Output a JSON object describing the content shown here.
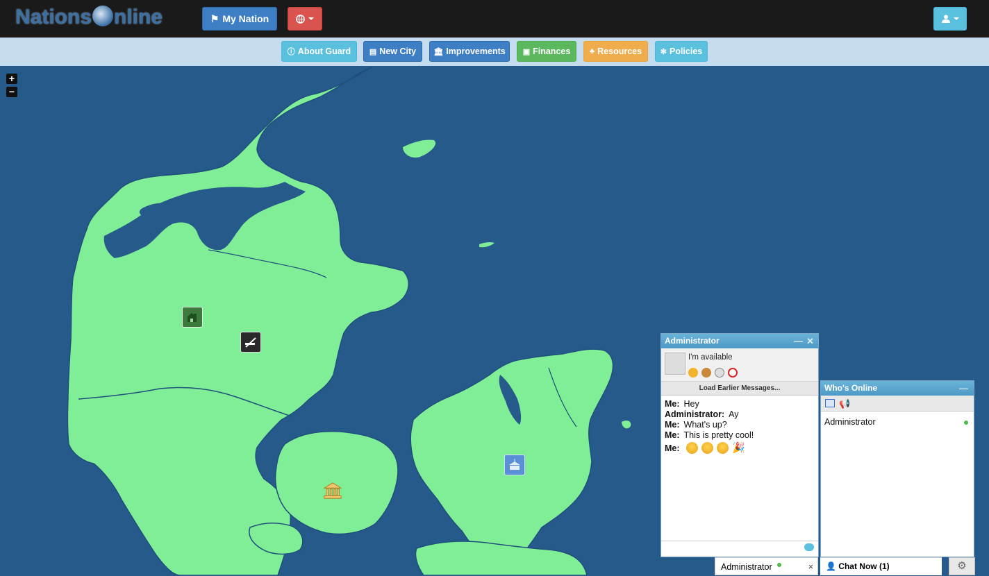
{
  "header": {
    "logo_text": "Nations",
    "logo_text2": "nline",
    "my_nation_label": "My Nation"
  },
  "subnav": {
    "about_guard": "About Guard",
    "new_city": "New City",
    "improvements": "Improvements",
    "finances": "Finances",
    "resources": "Resources",
    "policies": "Policies"
  },
  "map": {
    "zoom_in": "+",
    "zoom_out": "−",
    "land_color": "#80ee96",
    "water_color": "#265a8b"
  },
  "chat": {
    "title": "Administrator",
    "status": "I'm available",
    "load_earlier": "Load Earlier Messages...",
    "messages": [
      {
        "sender": "Me:",
        "text": "Hey"
      },
      {
        "sender": "Administrator:",
        "text": "Ay"
      },
      {
        "sender": "Me:",
        "text": "What's up?"
      },
      {
        "sender": "Me:",
        "text": "This is pretty cool!"
      },
      {
        "sender": "Me:",
        "text": ""
      }
    ]
  },
  "whos_online": {
    "title": "Who's Online",
    "user": "Administrator"
  },
  "bottom": {
    "chat_tab": "Administrator",
    "close": "×",
    "chat_now": "Chat Now (1)"
  }
}
